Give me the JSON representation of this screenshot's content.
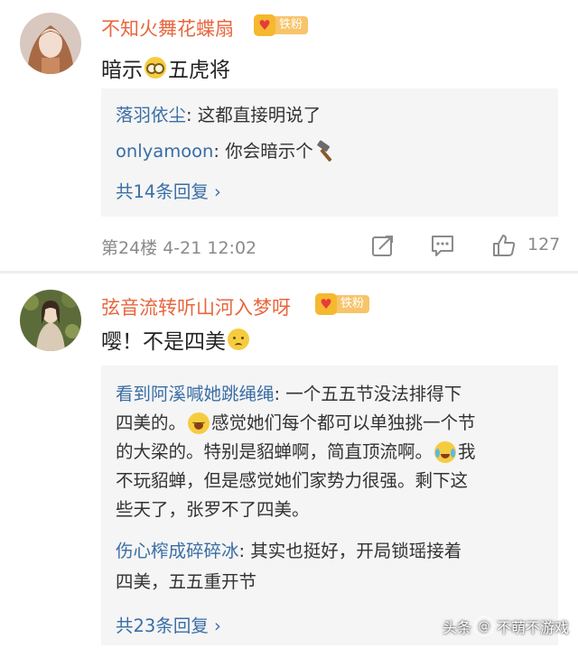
{
  "comments": [
    {
      "username": "不知火舞花蝶扇",
      "fan_badge": "铁粉",
      "text_before": "暗示",
      "emoji1": "glasses-emoji",
      "text_after": "五虎将",
      "replies": [
        {
          "name": "落羽依尘",
          "text": ": 这都直接明说了"
        },
        {
          "name": "onlyamoon",
          "text": ": 你会暗示个"
        }
      ],
      "reply_icon": "hammer-icon",
      "more_replies": "共14条回复 ›",
      "floor_info": "第24楼 4-21 12:02",
      "like_count": "127"
    },
    {
      "username": "弦音流转听山河入梦呀",
      "fan_badge": "铁粉",
      "text": "嘤！不是四美",
      "emoji1": "sad-emoji",
      "reply1_name": "看到阿溪喊她跳绳绳",
      "reply1_lines": [
        ": 一个五五节没法排得下",
        "四美的。",
        "感觉她们每个都可以单独挑一个节",
        "的大梁的。特别是貂蝉啊，简直顶流啊。",
        "我",
        "不玩貂蝉，但是感觉她们家势力很强。剩下这",
        "些天了，张罗不了四美。"
      ],
      "reply2_name": "伤心榨成碎碎冰",
      "reply2_lines": [
        ": 其实也挺好，开局锁瑶接着",
        "四美，五五重开节"
      ],
      "more_replies": "共23条回复 ›"
    }
  ],
  "watermark": {
    "prefix": "头条",
    "at": "@",
    "account": "不萌不游戏"
  },
  "colors": {
    "username": "#e8663d",
    "link": "#3a6ea5",
    "reply_bg": "#f5f5f5",
    "meta": "#8a8a8a"
  }
}
